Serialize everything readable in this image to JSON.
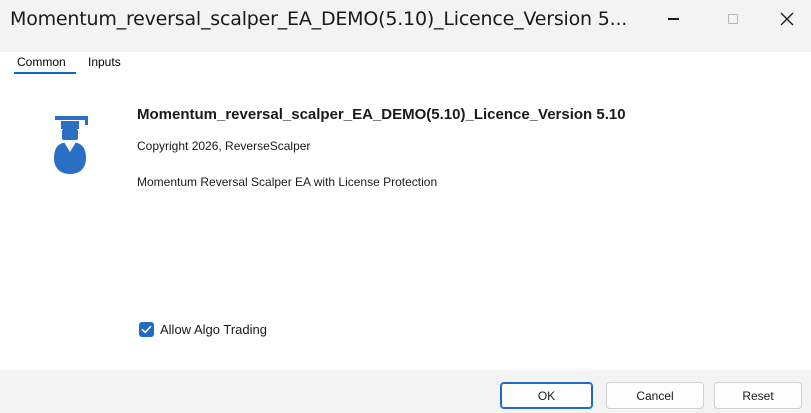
{
  "window": {
    "title": "Momentum_reversal_scalper_EA_DEMO(5.10)_Licence_Version 5...",
    "controls": {
      "minimize_icon": "minimize-icon",
      "maximize_icon": "maximize-icon",
      "close_icon": "close-icon",
      "close_glyph": "✕"
    }
  },
  "tabs": [
    {
      "label": "Common",
      "active": true
    },
    {
      "label": "Inputs",
      "active": false
    }
  ],
  "program": {
    "icon": "graduate-icon",
    "name": "Momentum_reversal_scalper_EA_DEMO(5.10)_Licence_Version 5.10",
    "copyright": "Copyright 2026, ReverseScalper",
    "description": "Momentum Reversal Scalper EA with License Protection"
  },
  "options": {
    "allow_algo_trading": {
      "label": "Allow Algo Trading",
      "checked": true
    }
  },
  "footer": {
    "ok_label": "OK",
    "cancel_label": "Cancel",
    "reset_label": "Reset"
  },
  "colors": {
    "accent": "#1f6ac6",
    "icon_blue": "#2a6fc4",
    "background": "#f3f3f3",
    "panel": "#ffffff"
  }
}
